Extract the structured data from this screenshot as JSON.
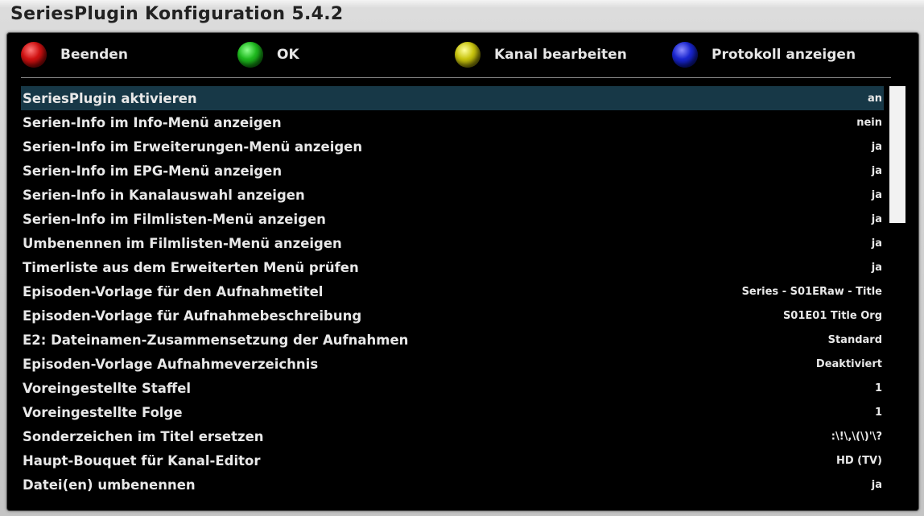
{
  "window": {
    "title": "SeriesPlugin Konfiguration 5.4.2"
  },
  "buttons": {
    "red": {
      "label": "Beenden",
      "color": "#d01212",
      "icon": "red-button-icon"
    },
    "green": {
      "label": "OK",
      "color": "#1fba1f",
      "icon": "green-button-icon"
    },
    "yellow": {
      "label": "Kanal bearbeiten",
      "color": "#c8c40e",
      "icon": "yellow-button-icon"
    },
    "blue": {
      "label": "Protokoll anzeigen",
      "color": "#1a26d0",
      "icon": "blue-button-icon"
    }
  },
  "settings": [
    {
      "label": "SeriesPlugin aktivieren",
      "value": "an",
      "selected": true
    },
    {
      "label": "Serien-Info im Info-Menü anzeigen",
      "value": "nein"
    },
    {
      "label": "Serien-Info im Erweiterungen-Menü anzeigen",
      "value": "ja"
    },
    {
      "label": "Serien-Info im EPG-Menü anzeigen",
      "value": "ja"
    },
    {
      "label": "Serien-Info in Kanalauswahl anzeigen",
      "value": "ja"
    },
    {
      "label": "Serien-Info im Filmlisten-Menü anzeigen",
      "value": "ja"
    },
    {
      "label": "Umbenennen im Filmlisten-Menü anzeigen",
      "value": "ja"
    },
    {
      "label": "Timerliste aus dem Erweiterten Menü prüfen",
      "value": "ja"
    },
    {
      "label": "Episoden-Vorlage für den Aufnahmetitel",
      "value": "Series - S01ERaw - Title"
    },
    {
      "label": "Episoden-Vorlage für Aufnahmebeschreibung",
      "value": "S01E01 Title Org"
    },
    {
      "label": "E2: Dateinamen-Zusammensetzung der Aufnahmen",
      "value": "Standard"
    },
    {
      "label": "Episoden-Vorlage Aufnahmeverzeichnis",
      "value": "Deaktiviert"
    },
    {
      "label": "Voreingestellte Staffel",
      "value": "1"
    },
    {
      "label": "Voreingestellte Folge",
      "value": "1"
    },
    {
      "label": "Sonderzeichen im Titel ersetzen",
      "value": ":\\!\\,\\(\\)'\\?"
    },
    {
      "label": "Haupt-Bouquet für Kanal-Editor",
      "value": "HD (TV)"
    },
    {
      "label": "Datei(en) umbenennen",
      "value": "ja"
    }
  ],
  "colors": {
    "selection": "#173847",
    "panel_background": "#000000",
    "text": "#e8e8e8"
  }
}
